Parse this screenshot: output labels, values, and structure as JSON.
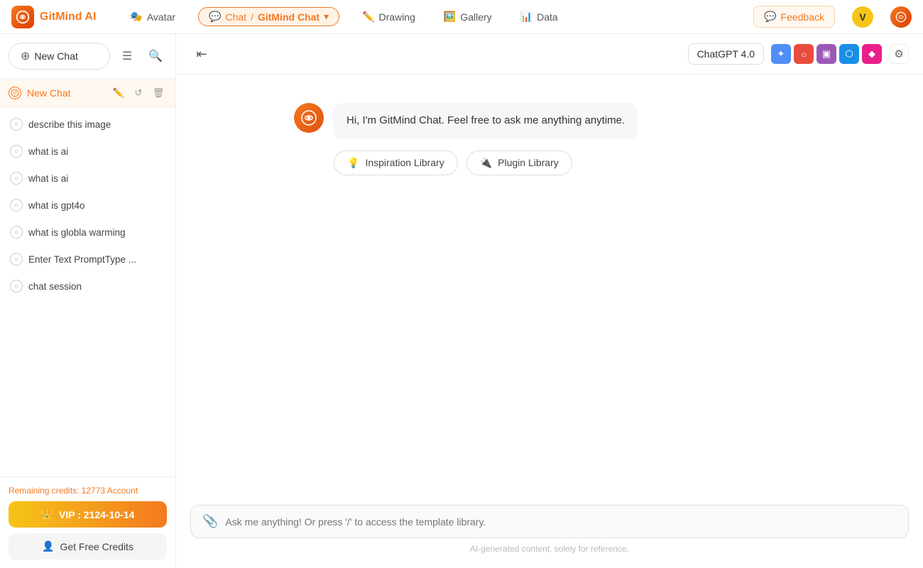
{
  "app": {
    "name": "GitMind AI",
    "logo_text": "AI"
  },
  "topnav": {
    "items": [
      {
        "id": "avatar",
        "label": "Avatar",
        "icon": "🎭"
      },
      {
        "id": "chat",
        "label": "Chat",
        "icon": "💬",
        "active": true
      },
      {
        "id": "gitmind-chat",
        "label": "GitMind Chat",
        "icon": "",
        "active": true
      },
      {
        "id": "drawing",
        "label": "Drawing",
        "icon": "✏️"
      },
      {
        "id": "gallery",
        "label": "Gallery",
        "icon": "🖼️"
      },
      {
        "id": "data",
        "label": "Data",
        "icon": "📊"
      }
    ],
    "feedback_label": "Feedback",
    "user_initial": "V"
  },
  "sidebar": {
    "new_chat_label": "New Chat",
    "current_chat": {
      "label": "New Chat"
    },
    "chat_history": [
      {
        "label": "describe this image"
      },
      {
        "label": "what is ai"
      },
      {
        "label": "what is ai"
      },
      {
        "label": "what is gpt4o"
      },
      {
        "label": "what is globla warming"
      },
      {
        "label": "Enter Text PromptType ..."
      },
      {
        "label": "chat session"
      }
    ],
    "credits_text": "Remaining credits: 12773",
    "account_label": "Account",
    "vip_label": "VIP : 2124-10-14",
    "free_credits_label": "Get Free Credits"
  },
  "chat": {
    "collapse_icon": "☰",
    "model": {
      "name": "ChatGPT 4.0"
    },
    "tools": [
      {
        "id": "tool1",
        "icon": "🔵",
        "color": "#4f8ef7"
      },
      {
        "id": "tool2",
        "icon": "🔴",
        "color": "#e74c3c"
      },
      {
        "id": "tool3",
        "icon": "🟣",
        "color": "#9b59b6"
      },
      {
        "id": "tool4",
        "icon": "🔷",
        "color": "#1a8fe8"
      },
      {
        "id": "tool5",
        "icon": "🟤",
        "color": "#e91e8c"
      }
    ],
    "welcome_message": "Hi, I'm GitMind Chat. Feel free to ask me anything anytime.",
    "inspiration_library_label": "Inspiration Library",
    "plugin_library_label": "Plugin Library",
    "input_placeholder": "Ask me anything! Or press '/' to access the template library.",
    "footer_note": "AI-generated content, solely for reference."
  }
}
